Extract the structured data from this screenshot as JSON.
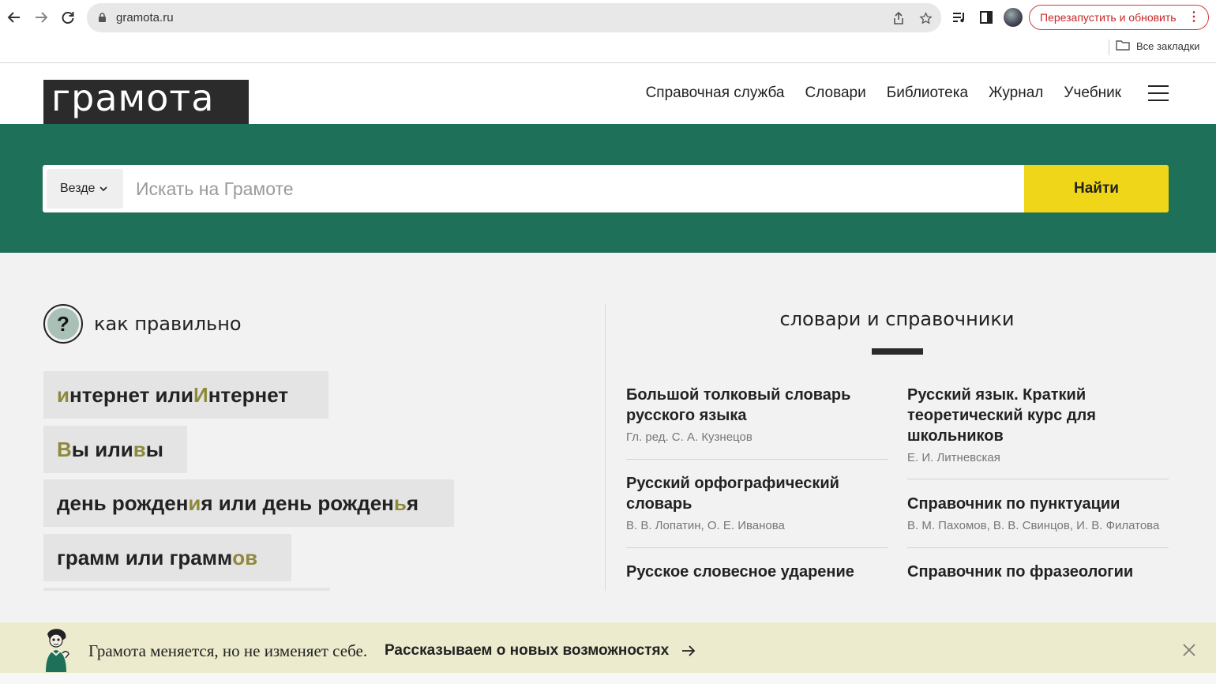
{
  "browser": {
    "url": "gramota.ru",
    "relaunch_label": "Перезапустить и обновить",
    "bookmarks_label": "Все закладки"
  },
  "header": {
    "logo": "грамота",
    "nav": [
      "Справочная служба",
      "Словари",
      "Библиотека",
      "Журнал",
      "Учебник"
    ]
  },
  "search": {
    "scope_label": "Везде",
    "placeholder": "Искать на Грамоте",
    "button_label": "Найти"
  },
  "how_correct": {
    "title": "как правильно",
    "items": [
      [
        {
          "t": "и",
          "hl": true
        },
        {
          "t": "нтернет или ",
          "hl": false
        },
        {
          "t": "И",
          "hl": true
        },
        {
          "t": "нтернет",
          "hl": false
        }
      ],
      [
        {
          "t": "В",
          "hl": true
        },
        {
          "t": "ы или ",
          "hl": false
        },
        {
          "t": "в",
          "hl": true
        },
        {
          "t": "ы",
          "hl": false
        }
      ],
      [
        {
          "t": "день рожден",
          "hl": false
        },
        {
          "t": "и",
          "hl": true
        },
        {
          "t": "я или день рожден",
          "hl": false
        },
        {
          "t": "ь",
          "hl": true
        },
        {
          "t": "я",
          "hl": false
        }
      ],
      [
        {
          "t": "грамм или грамм",
          "hl": false
        },
        {
          "t": "ов",
          "hl": true
        }
      ]
    ]
  },
  "dictionaries": {
    "title": "словари и справочники",
    "left": [
      {
        "title": "Большой толковый словарь русского языка",
        "authors": "Гл. ред. С. А. Кузнецов"
      },
      {
        "title": "Русский орфографический словарь",
        "authors": "В. В. Лопатин, О. Е. Иванова"
      },
      {
        "title": "Русское словесное ударение",
        "authors": ""
      }
    ],
    "right": [
      {
        "title": "Русский язык. Краткий теоретический курс для школьников",
        "authors": "Е. И. Литневская"
      },
      {
        "title": "Справочник по пунктуации",
        "authors": "В. М. Пахомов, В. В. Свинцов, И. В. Филатова"
      },
      {
        "title": "Справочник по фразеологии",
        "authors": ""
      }
    ]
  },
  "banner": {
    "text": "Грамота меняется, но не изменяет себе.",
    "link": "Рассказываем о новых возможностях"
  },
  "colors": {
    "brand_green": "#1e7058",
    "button_yellow": "#f0d618",
    "highlight": "#8e8a3c",
    "banner_bg": "#ecebcd"
  }
}
